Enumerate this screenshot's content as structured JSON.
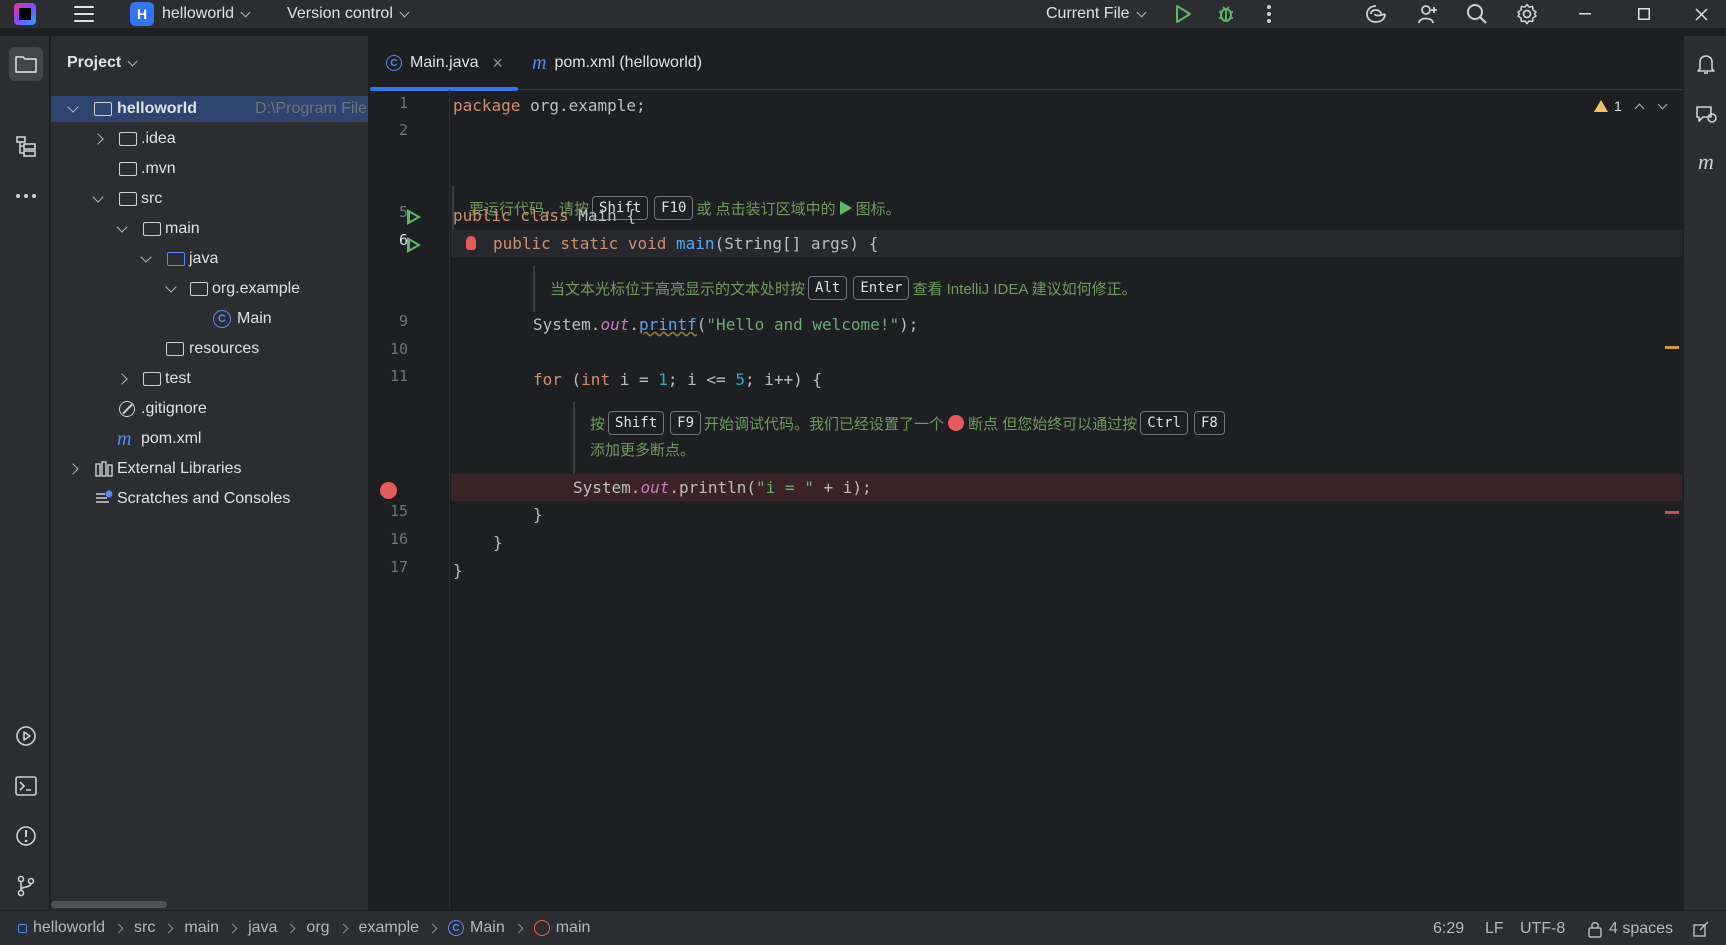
{
  "titlebar": {
    "project_initial": "H",
    "project_name": "helloworld",
    "vcs_label": "Version control",
    "run_config": "Current File"
  },
  "project_panel": {
    "title": "Project",
    "tree": [
      {
        "label": "helloworld",
        "path": "D:\\Program Files\\JetBra"
      },
      {
        "label": ".idea"
      },
      {
        "label": ".mvn"
      },
      {
        "label": "src"
      },
      {
        "label": "main"
      },
      {
        "label": "java"
      },
      {
        "label": "org.example"
      },
      {
        "label": "Main"
      },
      {
        "label": "resources"
      },
      {
        "label": "test"
      },
      {
        "label": ".gitignore"
      },
      {
        "label": "pom.xml"
      },
      {
        "label": "External Libraries"
      },
      {
        "label": "Scratches and Consoles"
      }
    ]
  },
  "editor": {
    "tabs": [
      {
        "label": "Main.java",
        "close": "×"
      },
      {
        "label": "pom.xml (helloworld)"
      }
    ],
    "warnings_count": "1",
    "line_numbers": [
      "1",
      "2",
      "5",
      "6",
      "9",
      "10",
      "11",
      "15",
      "16",
      "17"
    ],
    "code": {
      "l1_kw": "package",
      "l1_rest": " org.example;",
      "l5_kw": "public class",
      "l5_rest": " Main {",
      "l6_kw": "public static void",
      "l6_fn": "main",
      "l6_rest": "(String[] args) {",
      "l9_a": "System.",
      "l9_field": "out",
      "l9_b": ".",
      "l9_fn": "printf",
      "l9_c": "(",
      "l9_str": "\"Hello and welcome!\"",
      "l9_d": ");",
      "l11_kw": "for",
      "l11_a": " (",
      "l11_kw2": "int",
      "l11_b": " i = ",
      "l11_n1": "1",
      "l11_c": "; i <= ",
      "l11_n2": "5",
      "l11_d": "; i++) {",
      "l14_a": "System.",
      "l14_field": "out",
      "l14_b": ".println(",
      "l14_str": "\"i = \"",
      "l14_c": " + i);",
      "l15": "}",
      "l16": "}",
      "l17": "}"
    },
    "hint1": {
      "pre": "要运行代码，请按",
      "k1": "Shift",
      "k2": "F10",
      "mid": "或 点击装订区域中的",
      "post": "图标。"
    },
    "hint2": {
      "pre": "当文本光标位于高亮显示的文本处时按",
      "k1": "Alt",
      "k2": "Enter",
      "post": "查看 IntelliJ IDEA 建议如何修正。"
    },
    "hint3": {
      "pre": "按",
      "k1": "Shift",
      "k2": "F9",
      "mid": "开始调试代码。我们已经设置了一个",
      "mid2": "断点 但您始终可以通过按",
      "k3": "Ctrl",
      "k4": "F8",
      "line2": "添加更多断点。"
    }
  },
  "statusbar": {
    "breadcrumbs": [
      "helloworld",
      "src",
      "main",
      "java",
      "org",
      "example",
      "Main",
      "main"
    ],
    "position": "6:29",
    "line_sep": "LF",
    "encoding": "UTF-8",
    "indent": "4 spaces"
  },
  "colors": {
    "accent": "#3574f0",
    "run_green": "#5fb865",
    "breakpoint_red": "#e55b5b",
    "warning_yellow": "#f2c55c"
  }
}
